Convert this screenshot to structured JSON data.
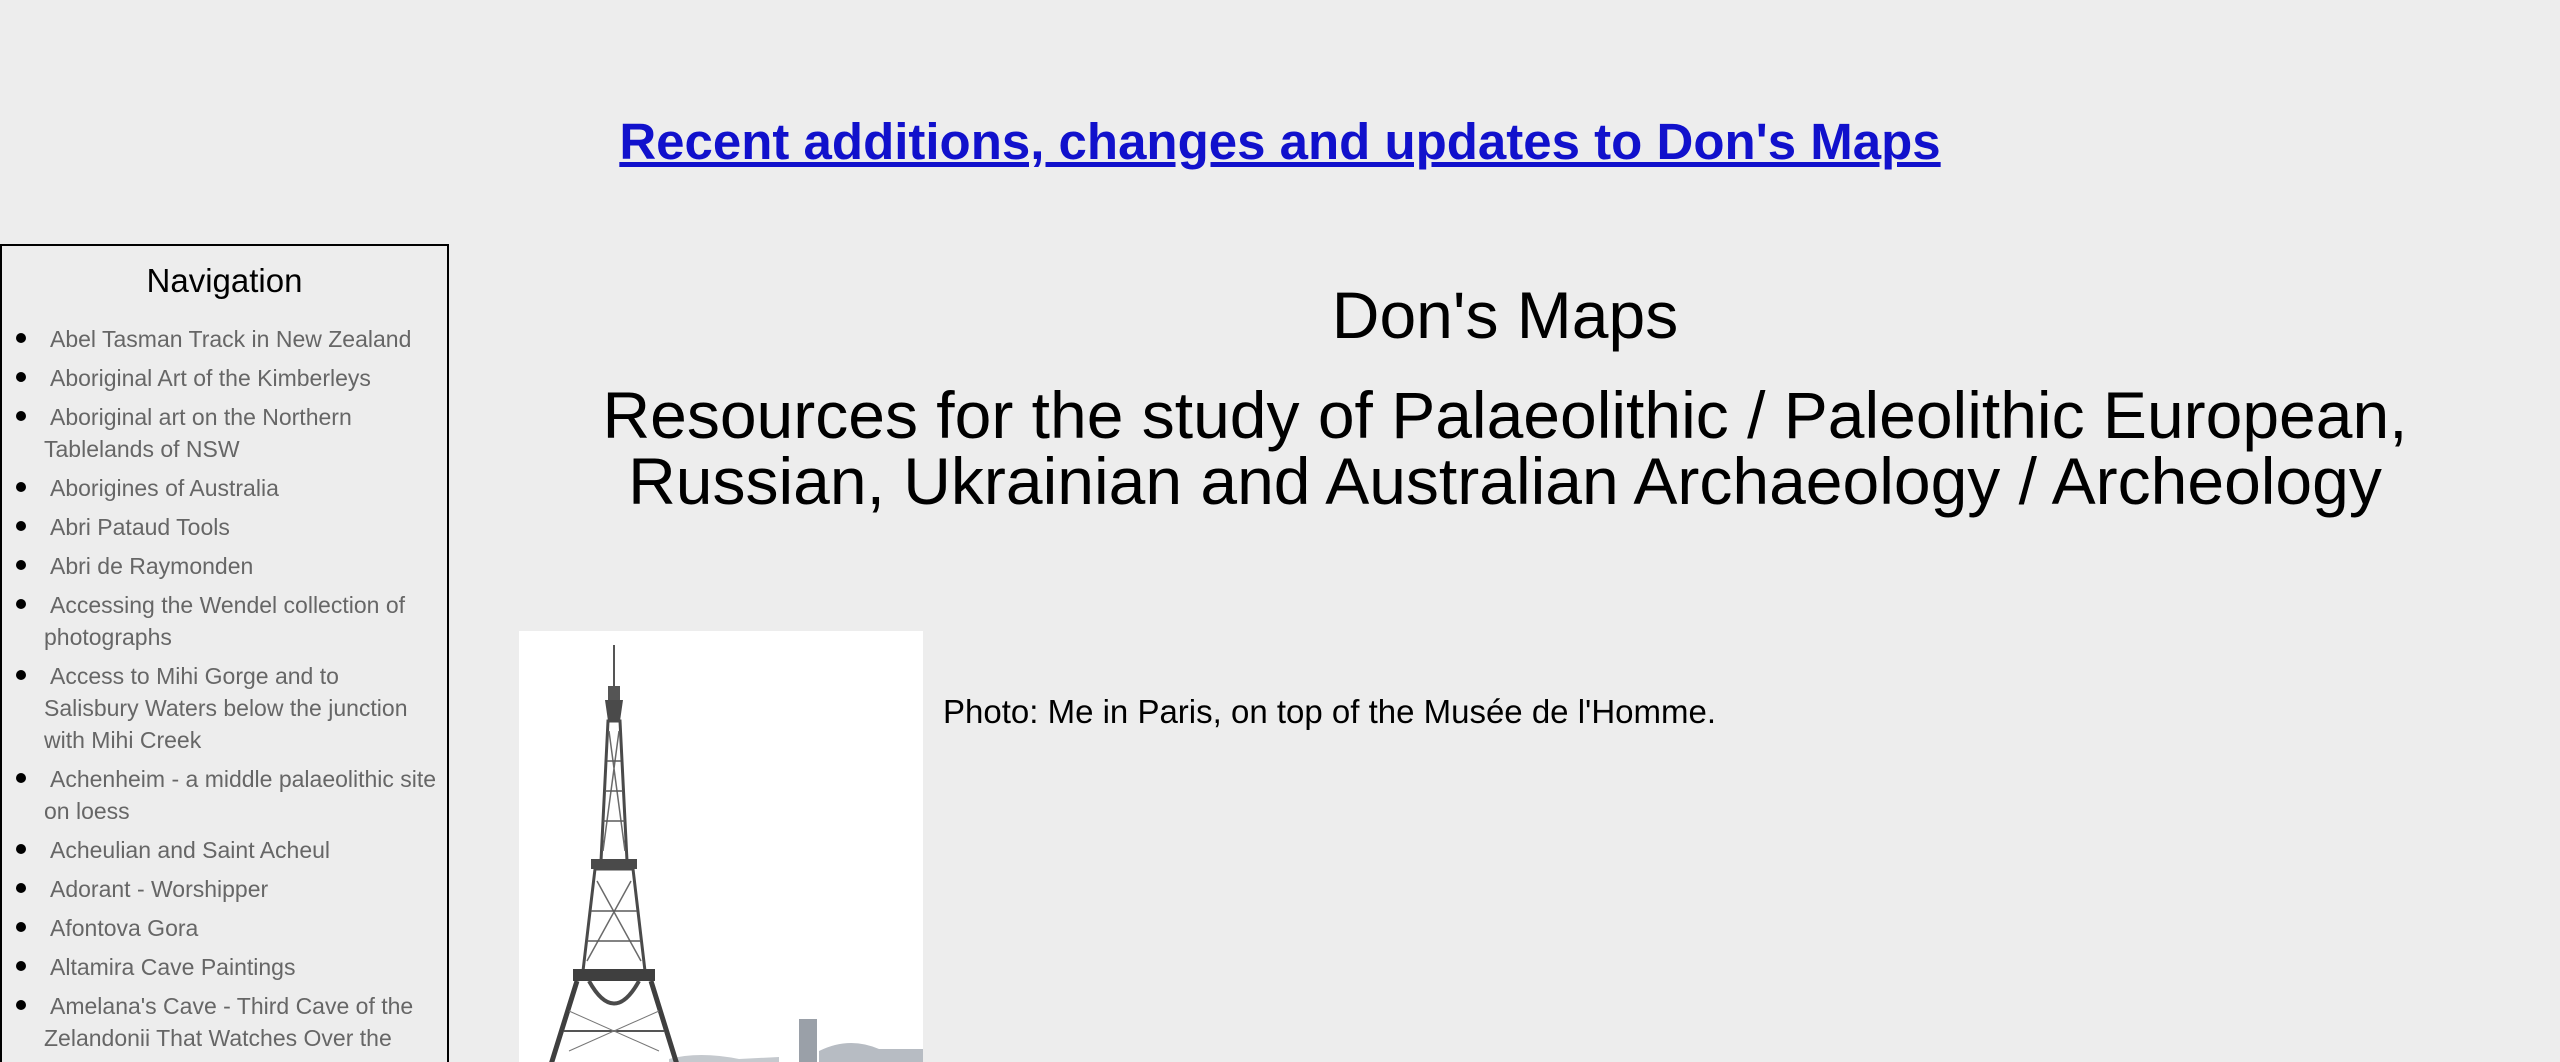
{
  "header": {
    "updates_link": "Recent additions, changes and updates to Don's Maps"
  },
  "sidebar": {
    "title": "Navigation",
    "items": [
      {
        "label": "Abel Tasman Track in New Zealand"
      },
      {
        "label": "Aboriginal Art of the Kimberleys"
      },
      {
        "label": "Aboriginal art on the Northern Tablelands of NSW"
      },
      {
        "label": "Aborigines of Australia"
      },
      {
        "label": "Abri Pataud Tools"
      },
      {
        "label": "Abri de Raymonden"
      },
      {
        "label": "Accessing the Wendel collection of photographs"
      },
      {
        "label": "Access to Mihi Gorge and to Salisbury Waters below the junction with Mihi Creek"
      },
      {
        "label": "Achenheim - a middle palaeolithic site on loess"
      },
      {
        "label": "Acheulian and Saint Acheul"
      },
      {
        "label": "Adorant - Worshipper"
      },
      {
        "label": "Afontova Gora"
      },
      {
        "label": "Altamira Cave Paintings"
      },
      {
        "label": "Amelana's Cave - Third Cave of the Zelandonii That Watches Over the Most"
      }
    ]
  },
  "main": {
    "title": "Don's Maps",
    "subtitle": "Resources for the study of Palaeolithic / Paleolithic European, Russian, Ukrainian and Australian Archaeology / Archeology",
    "photo_caption": "Photo: Me in Paris, on top of the Musée de l'Homme."
  },
  "colors": {
    "link": "#1111cc",
    "nav_text": "#666666",
    "background": "#ededed"
  }
}
